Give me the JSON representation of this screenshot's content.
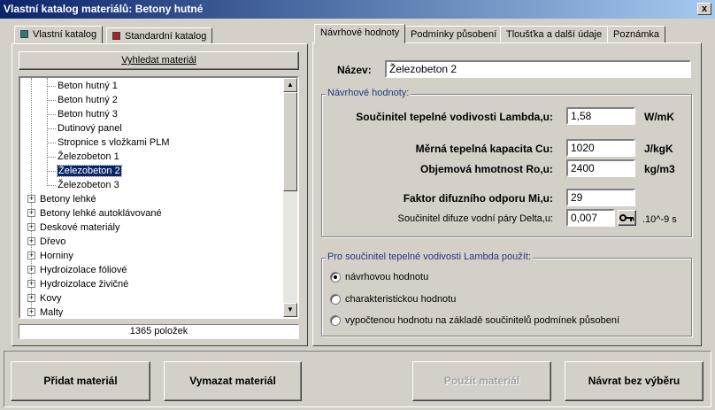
{
  "window": {
    "title": "Vlastní katalog materiálů:  Betony hutné",
    "close_glyph": "x"
  },
  "left": {
    "tabs": [
      {
        "label": "Vlastní katalog",
        "icon_color": "#2a7a78"
      },
      {
        "label": "Standardní katalog",
        "icon_color": "#b02020"
      }
    ],
    "search_button": "Vyhledat materiál",
    "tree_children": [
      "Beton hutný 1",
      "Beton hutný 2",
      "Beton hutný 3",
      "Dutinový panel",
      "Stropnice s vložkami PLM",
      "Železobeton 1",
      "Železobeton 2",
      "Železobeton 3"
    ],
    "selected_child": "Železobeton 2",
    "tree_groups": [
      "Betony lehké",
      "Betony lehké autoklávované",
      "Deskové materiály",
      "Dřevo",
      "Horniny",
      "Hydroizolace fóliové",
      "Hydroizolace živičné",
      "Kovy",
      "Malty"
    ],
    "expand_glyph": "+",
    "scroll_up_glyph": "▲",
    "scroll_down_glyph": "▼",
    "count_text": "1365 položek"
  },
  "right": {
    "tabs": [
      "Návrhové hodnoty",
      "Podmínky působení",
      "Tloušťka a další údaje",
      "Poznámka"
    ],
    "name_label": "Název:",
    "name_value": "Železobeton 2",
    "group1_title": "Návrhové hodnoty:",
    "rows": [
      {
        "label": "Součinitel tepelné vodivosti  Lambda,u:",
        "value": "1,58",
        "unit": "W/mK"
      },
      {
        "label": "Měrná tepelná kapacita  Cu:",
        "value": "1020",
        "unit": "J/kgK"
      },
      {
        "label": "Objemová hmotnost  Ro,u:",
        "value": "2400",
        "unit": "kg/m3"
      },
      {
        "label": "Faktor difuzního odporu  Mi,u:",
        "value": "29",
        "unit": ""
      },
      {
        "label": "Součinitel difuze vodní páry  Delta,u:",
        "value": "0,007",
        "unit": ".10^-9 s"
      }
    ],
    "key_icon_name": "key-icon",
    "group2_title": "Pro součinitel tepelné vodivosti Lambda použít:",
    "radios": [
      {
        "label": "návrhovou hodnotu",
        "checked": true
      },
      {
        "label": "charakteristickou hodnotu",
        "checked": false
      },
      {
        "label": "vypočtenou hodnotu na základě součinitelů podmínek působení",
        "checked": false
      }
    ]
  },
  "buttons": {
    "add": "Přidat materiál",
    "delete": "Vymazat materiál",
    "use": "Použít materiál",
    "back": "Návrat bez výběru"
  }
}
